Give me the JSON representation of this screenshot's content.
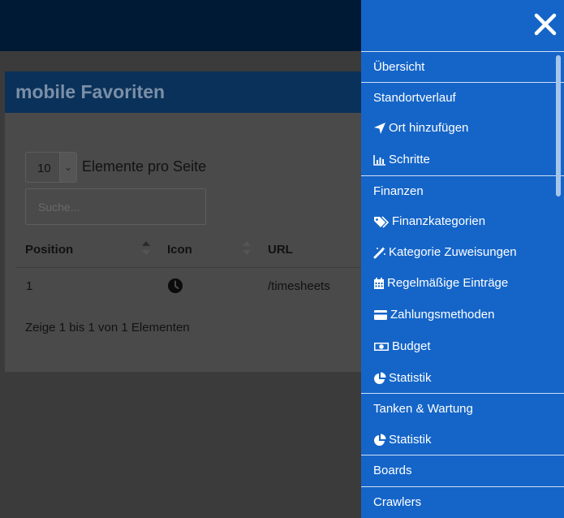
{
  "card": {
    "title": "mobile Favoriten",
    "page_length": "10",
    "page_length_label": "Elemente pro Seite",
    "search_placeholder": "Suche..."
  },
  "table": {
    "columns": [
      "Position",
      "Icon",
      "URL"
    ],
    "rows": [
      {
        "position": "1",
        "icon": "clock-icon",
        "url": "/timesheets"
      }
    ],
    "info": "Zeige 1 bis 1 von 1 Elementen"
  },
  "sidebar": {
    "items": [
      {
        "label": "Übersicht",
        "type": "section"
      },
      {
        "label": "Standortverlauf",
        "type": "section"
      },
      {
        "label": "Ort hinzufügen",
        "type": "sub",
        "icon": "location-arrow-icon"
      },
      {
        "label": "Schritte",
        "type": "sub",
        "icon": "bar-chart-icon"
      },
      {
        "label": "Finanzen",
        "type": "section"
      },
      {
        "label": "Finanzkategorien",
        "type": "sub",
        "icon": "tags-icon"
      },
      {
        "label": "Kategorie Zuweisungen",
        "type": "sub",
        "icon": "magic-wand-icon"
      },
      {
        "label": "Regelmäßige Einträge",
        "type": "sub",
        "icon": "calendar-icon"
      },
      {
        "label": "Zahlungsmethoden",
        "type": "sub",
        "icon": "credit-card-icon"
      },
      {
        "label": "Budget",
        "type": "sub",
        "icon": "money-bill-icon"
      },
      {
        "label": "Statistik",
        "type": "sub",
        "icon": "pie-chart-icon"
      },
      {
        "label": "Tanken & Wartung",
        "type": "section"
      },
      {
        "label": "Statistik",
        "type": "sub",
        "icon": "pie-chart-icon"
      },
      {
        "label": "Boards",
        "type": "section"
      },
      {
        "label": "Crawlers",
        "type": "section"
      }
    ]
  },
  "colors": {
    "topbar": "#001a35",
    "sidebar": "#1565c8",
    "card_header": "#0a3159"
  }
}
